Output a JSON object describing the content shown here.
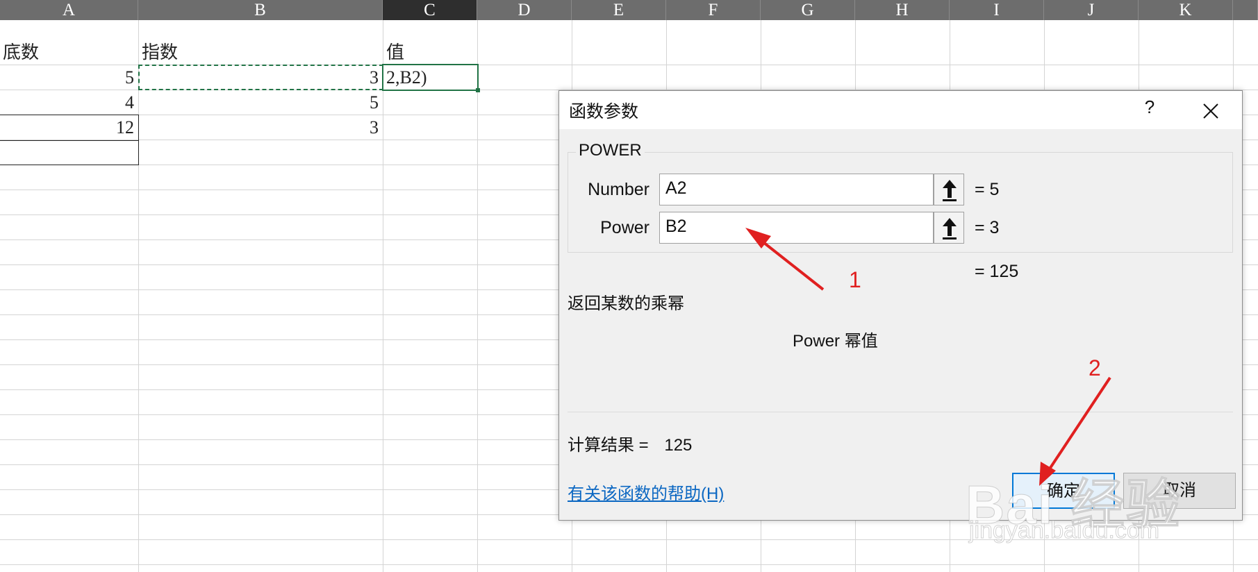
{
  "sheet": {
    "columns": [
      "A",
      "B",
      "C",
      "D",
      "E",
      "F",
      "G",
      "H",
      "I",
      "J",
      "K"
    ],
    "active_column": "C",
    "headers": {
      "a": "底数",
      "b": "指数",
      "c": "值"
    },
    "rows": [
      {
        "a": "5",
        "b": "3",
        "c": "2,B2)"
      },
      {
        "a": "4",
        "b": "5",
        "c": ""
      },
      {
        "a": "12",
        "b": "3",
        "c": ""
      }
    ]
  },
  "dialog": {
    "title": "函数参数",
    "help_symbol": "?",
    "close_symbol": "✕",
    "function_name": "POWER",
    "args": [
      {
        "label": "Number",
        "value": "A2",
        "result": "=  5"
      },
      {
        "label": "Power",
        "value": "B2",
        "result": "=  3"
      }
    ],
    "formula_result": "=  125",
    "description": "返回某数的乘幂",
    "param_description": "Power   幂值",
    "calc_result_label": "计算结果 =",
    "calc_result_value": "125",
    "help_link": "有关该函数的帮助(H)",
    "ok_label": "确定",
    "cancel_label": "取消"
  },
  "annotations": {
    "label_1": "1",
    "label_2": "2",
    "color": "#e02020"
  },
  "watermark": {
    "brand": "Bai 经验",
    "url": "jingyan.baidu.com"
  }
}
